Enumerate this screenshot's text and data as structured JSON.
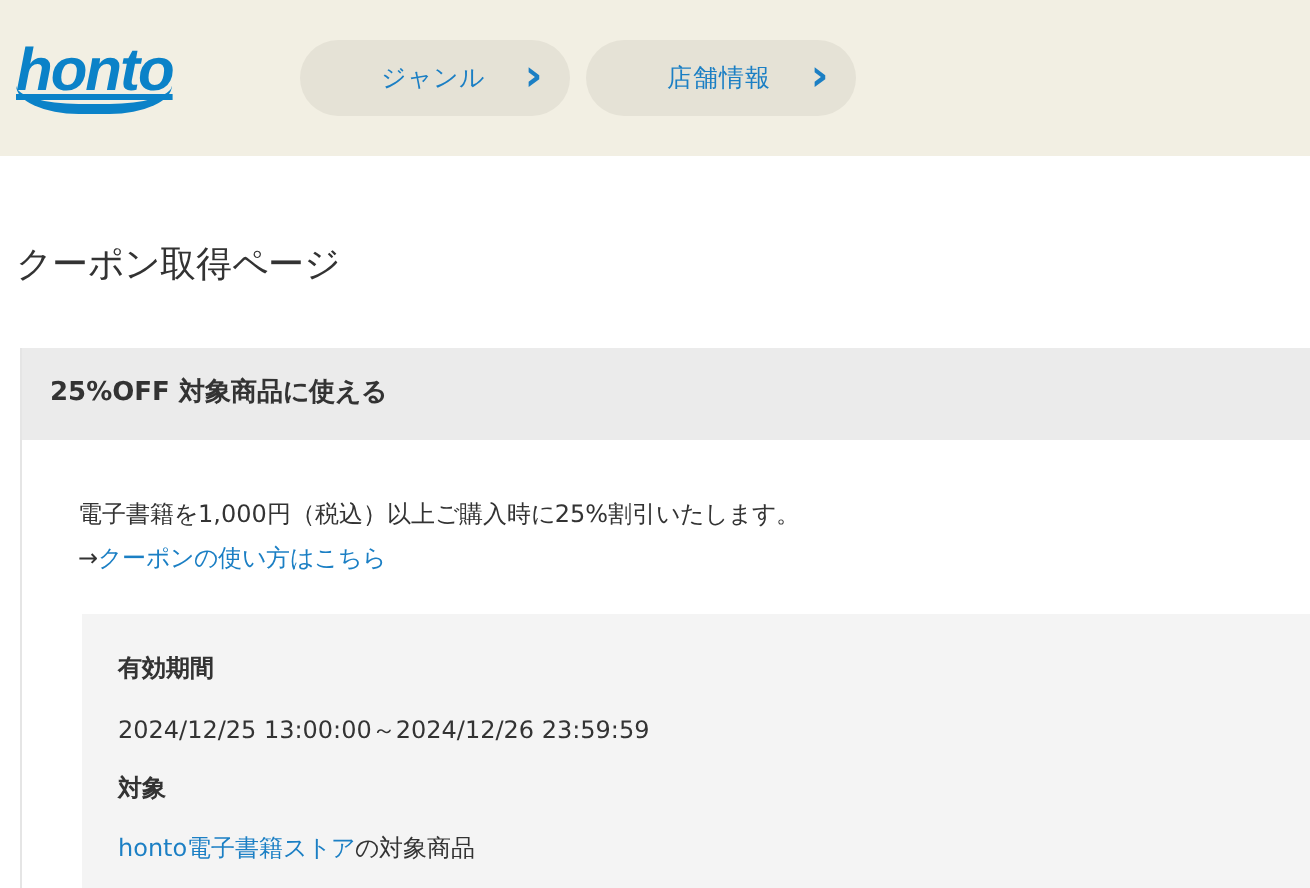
{
  "header": {
    "logo": "honto",
    "nav": [
      {
        "label": "ジャンル",
        "chevron": "›"
      },
      {
        "label": "店舗情報",
        "chevron": "›"
      }
    ]
  },
  "page_title": "クーポン取得ページ",
  "coupon": {
    "title": "25%OFF 対象商品に使える",
    "description": "電子書籍を1,000円（税込）以上ご購入時に25%割引いたします。",
    "howto": {
      "arrow": "→",
      "link": "クーポンの使い方はこちら"
    },
    "details": [
      {
        "label": "有効期間",
        "value": "2024/12/25 13:00:00～2024/12/26 23:59:59"
      },
      {
        "label": "対象",
        "link": "honto電子書籍ストア",
        "value": "の対象商品"
      }
    ]
  }
}
